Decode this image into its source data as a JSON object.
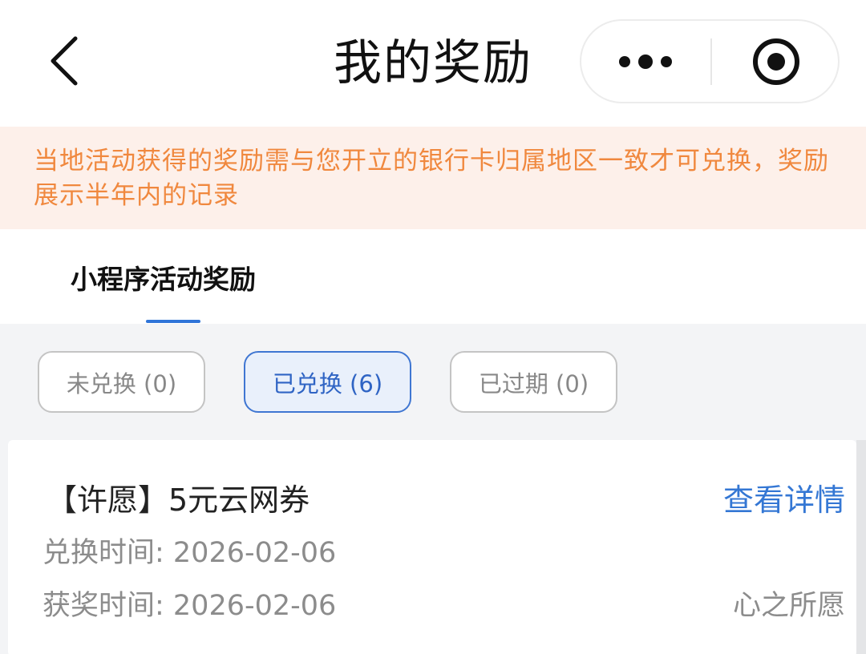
{
  "nav": {
    "title": "我的奖励",
    "back_icon": "chevron-left-icon",
    "more_icon": "more-dots-icon",
    "close_icon": "target-close-icon"
  },
  "notice": {
    "text": "当地活动获得的奖励需与您开立的银行卡归属地区一致才可兑换，奖励展示半年内的记录"
  },
  "tabs": [
    {
      "label": "小程序活动奖励",
      "active": true
    }
  ],
  "filters": [
    {
      "label": "未兑换 (0)",
      "active": false
    },
    {
      "label": "已兑换 (6)",
      "active": true
    },
    {
      "label": "已过期 (0)",
      "active": false
    }
  ],
  "reward": {
    "title": "【许愿】5元云网券",
    "detail_link": "查看详情",
    "redeem_time": "兑换时间: 2026-02-06",
    "award_time": "获奖时间: 2026-02-06",
    "source": "心之所愿"
  },
  "colors": {
    "accent": "#2f74d8",
    "notice_text": "#f0883e",
    "notice_bg": "#fdf0ea",
    "link": "#3477d4",
    "page_bg": "#f3f4f6"
  }
}
